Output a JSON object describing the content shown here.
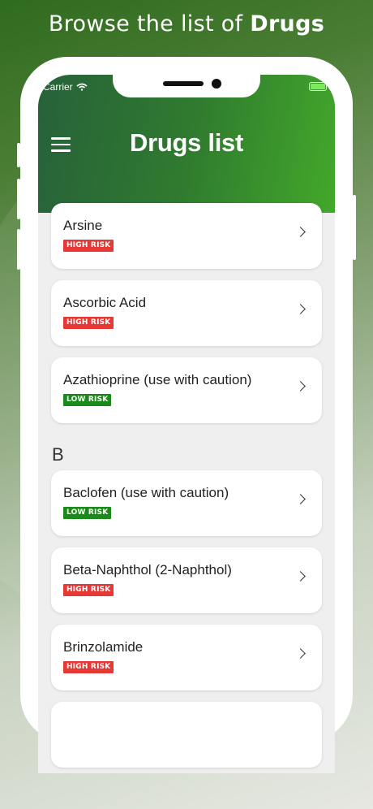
{
  "promo": {
    "prefix": "Browse the list of ",
    "emphasis": "Drugs"
  },
  "status_bar": {
    "carrier": "Carrier"
  },
  "header": {
    "title": "Drugs list"
  },
  "colors": {
    "high_risk": "#e53935",
    "low_risk": "#1b8a1b",
    "header_start": "#27613a",
    "header_end": "#43a82a"
  },
  "list": {
    "section_b": "B",
    "items": [
      {
        "name": "Arsine",
        "risk": "HIGH RISK",
        "risk_level": "high"
      },
      {
        "name": "Ascorbic Acid",
        "risk": "HIGH RISK",
        "risk_level": "high"
      },
      {
        "name": "Azathioprine (use with caution)",
        "risk": "LOW RISK",
        "risk_level": "low"
      },
      {
        "name": "Baclofen (use with caution)",
        "risk": "LOW RISK",
        "risk_level": "low"
      },
      {
        "name": "Beta-Naphthol (2-Naphthol)",
        "risk": "HIGH RISK",
        "risk_level": "high"
      },
      {
        "name": "Brinzolamide",
        "risk": "HIGH RISK",
        "risk_level": "high"
      }
    ]
  }
}
